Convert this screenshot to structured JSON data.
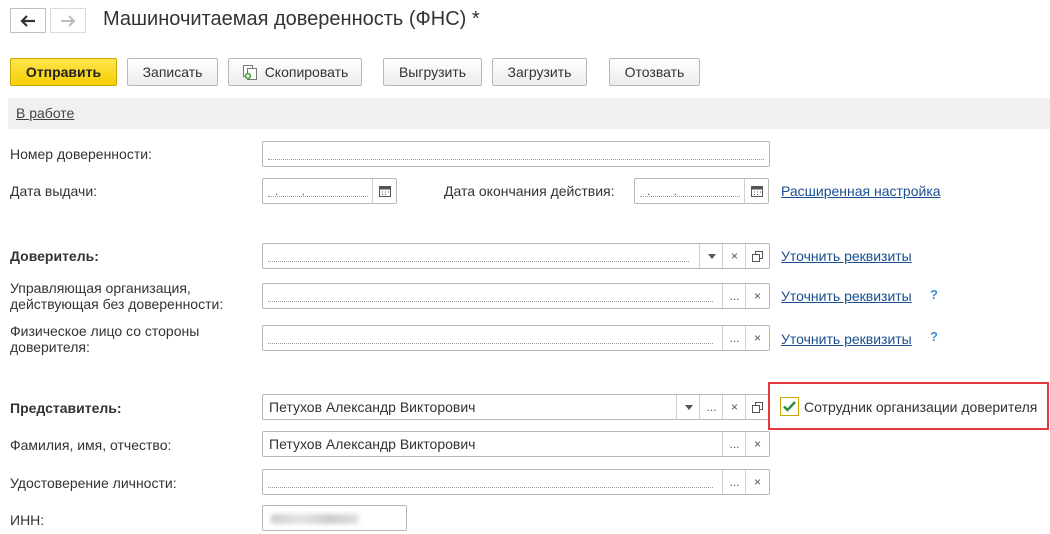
{
  "window": {
    "title": "Машиночитаемая доверенность (ФНС) *"
  },
  "nav": {
    "back_icon": "arrow-left-icon",
    "forward_icon": "arrow-right-icon"
  },
  "toolbar": {
    "send": "Отправить",
    "save": "Записать",
    "copy": "Скопировать",
    "export": "Выгрузить",
    "import": "Загрузить",
    "revoke": "Отозвать"
  },
  "status_group": {
    "label": "В работе"
  },
  "form": {
    "number_label": "Номер доверенности:",
    "issue_date_label": "Дата выдачи:",
    "issue_date_value": ". .",
    "end_date_label": "Дата окончания действия:",
    "end_date_value": ". .",
    "advanced_link": "Расширенная настройка",
    "principal_label": "Доверитель:",
    "principal_link": "Уточнить реквизиты",
    "managing_org_label_1": "Управляющая организация,",
    "managing_org_label_2": "действующая без доверенности:",
    "managing_org_link": "Уточнить реквизиты",
    "person_label_1": "Физическое лицо со стороны",
    "person_label_2": "доверителя:",
    "person_link": "Уточнить реквизиты",
    "representative_label": "Представитель:",
    "representative_value": "Петухов Александр Викторович",
    "employee_checkbox_label": "Сотрудник организации доверителя",
    "employee_checked": true,
    "fio_label": "Фамилия, имя, отчество:",
    "fio_value": "Петухов Александр Викторович",
    "id_doc_label": "Удостоверение личности:",
    "inn_label": "ИНН:",
    "help_mark": "?",
    "ellipsis": "...",
    "clear": "×"
  },
  "colors": {
    "accent_button": "#f5cf00",
    "link": "#1a4e8f",
    "highlight": "#e0393e",
    "help": "#3d8bd4"
  }
}
